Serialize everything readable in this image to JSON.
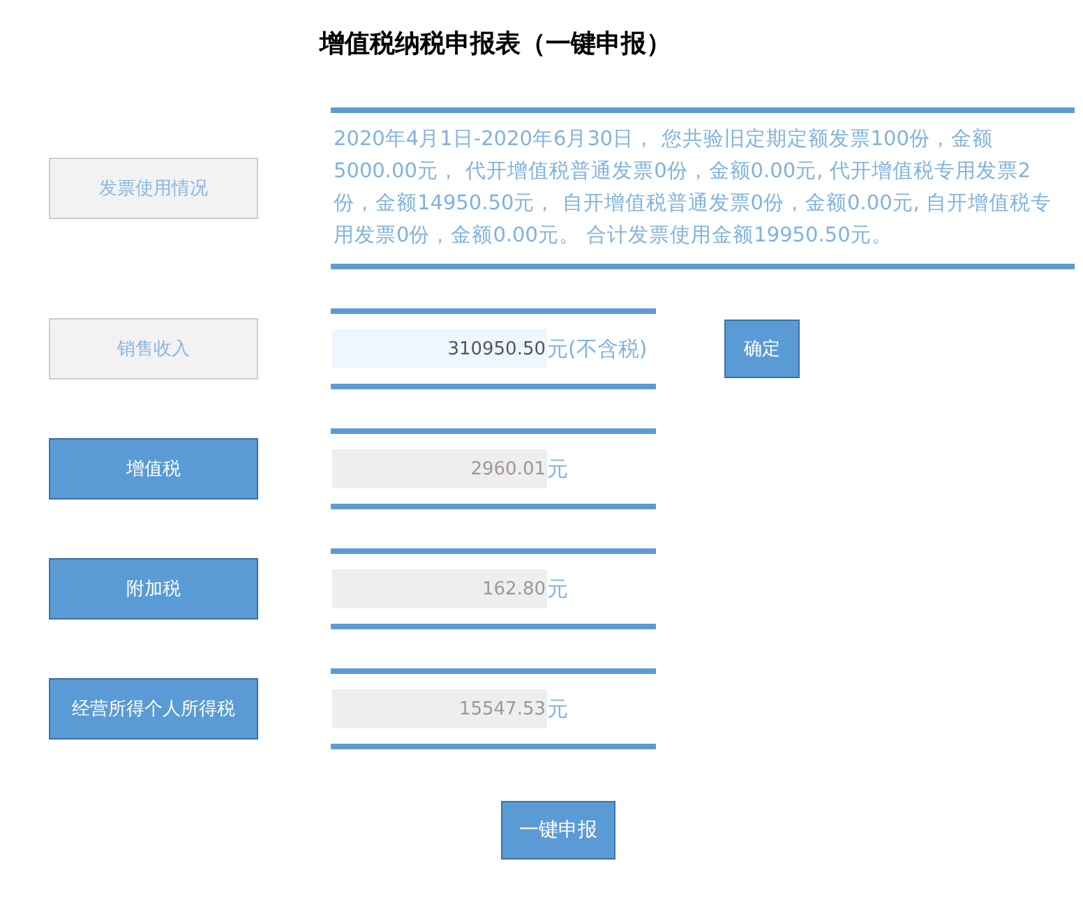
{
  "title": "增值税纳税申报表（一键申报）",
  "rows": [
    {
      "kind": "summary",
      "label": "发票使用情况",
      "active": false,
      "text": "2020年4月1日-2020年6月30日， 您共验旧定期定额发票100份，金额5000.00元， 代开增值税普通发票0份，金额0.00元, 代开增值税专用发票2份，金额14950.50元， 自开增值税普通发票0份，金额0.00元, 自开增值税专用发票0份，金额0.00元。 合计发票使用金额19950.50元。"
    },
    {
      "kind": "field",
      "label": "销售收入",
      "active": false,
      "value": "310950.50",
      "editable": true,
      "unit": "元(不含税)",
      "button": "确定"
    },
    {
      "kind": "field",
      "label": "增值税",
      "active": true,
      "value": "2960.01",
      "editable": false,
      "unit": "元"
    },
    {
      "kind": "field",
      "label": "附加税",
      "active": true,
      "value": "162.80",
      "editable": false,
      "unit": "元"
    },
    {
      "kind": "field",
      "label": "经营所得个人所得税",
      "active": true,
      "value": "15547.53",
      "editable": false,
      "unit": "元"
    }
  ],
  "submit": "一键申报"
}
